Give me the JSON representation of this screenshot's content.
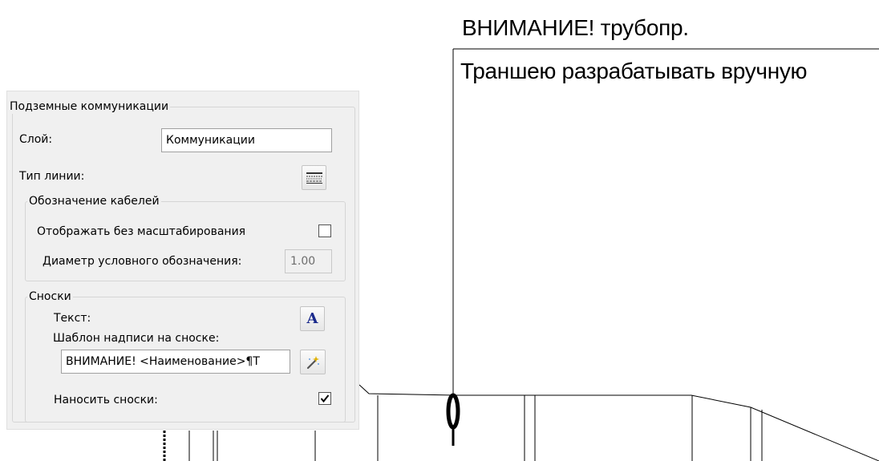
{
  "drawing": {
    "callout_title": "ВНИМАНИЕ! трубопр.",
    "callout_line1": "Траншею разрабатывать вручную"
  },
  "panel": {
    "section_title": "Подземные коммуникации",
    "layer_label": "Слой:",
    "layer_value": "Коммуникации",
    "linetype_label": "Тип линии:",
    "cables": {
      "title": "Обозначение кабелей",
      "no_scale_label": "Отображать без масштабирования",
      "no_scale_checked": false,
      "diameter_label": "Диаметр условного обозначения:",
      "diameter_value": "1.00"
    },
    "leaders": {
      "title": "Сноски",
      "text_label": "Текст:",
      "template_label": "Шаблон надписи на сноске:",
      "template_value": "ВНИМАНИЕ! <Наименование>¶Т",
      "apply_label": "Наносить сноски:",
      "apply_checked": true
    }
  },
  "colors": {
    "text_style_icon": "#1a2a8c",
    "panel_bg": "#f0f0f0"
  }
}
